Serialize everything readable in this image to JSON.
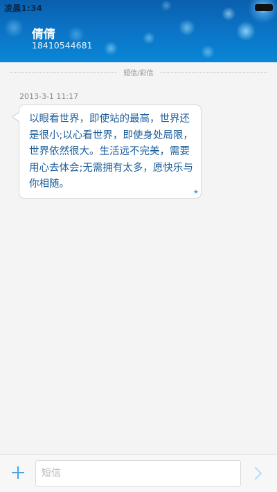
{
  "status_bar": {
    "time": "凌晨1:34"
  },
  "header": {
    "contact_name": "倩倩",
    "contact_number": "18410544681"
  },
  "divider": {
    "label": "短信/彩信"
  },
  "messages": [
    {
      "timestamp": "2013-3-1 11:17",
      "text": "以眼看世界，即使站的最高，世界还是很小;以心看世界，即使身处局限，世界依然很大。生活远不完美，需要用心去体会;无需拥有太多，愿快乐与你相随。",
      "starred": true
    }
  ],
  "compose": {
    "placeholder": "短信"
  },
  "colors": {
    "accent": "#4ba3e3",
    "message_text": "#1b5c9a",
    "header_blue": "#0b72c4"
  },
  "icons": {
    "add": "plus-icon",
    "send": "chevron-right-icon",
    "star": "star-icon",
    "battery": "battery-icon"
  }
}
